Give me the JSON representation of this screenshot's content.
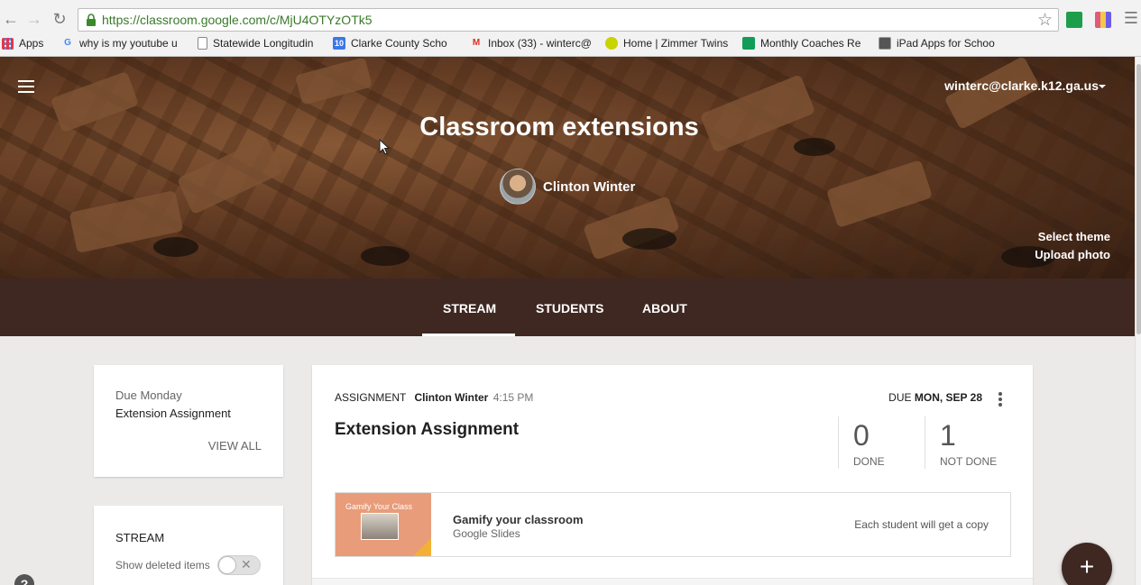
{
  "browser": {
    "url": "https://classroom.google.com/c/MjU4OTYzOTk5",
    "bookmarks": [
      {
        "label": "Apps",
        "icon": "apps-grid-icon"
      },
      {
        "label": "why is my youtube u",
        "icon": "google-icon"
      },
      {
        "label": "Statewide Longitudin",
        "icon": "document-icon"
      },
      {
        "label": "Clarke County Scho",
        "icon": "calendar-icon"
      },
      {
        "label": "Inbox (33) - winterc@",
        "icon": "gmail-icon"
      },
      {
        "label": "Home | Zimmer Twins",
        "icon": "zimmer-icon"
      },
      {
        "label": "Monthly Coaches Re",
        "icon": "sheets-icon"
      },
      {
        "label": "iPad Apps for Schoo",
        "icon": "bookmark-image-icon"
      }
    ]
  },
  "header": {
    "account": "winterc@clarke.k12.ga.us",
    "class_title": "Classroom extensions",
    "teacher": "Clinton Winter",
    "select_theme": "Select theme",
    "upload_photo": "Upload photo",
    "theme_color": "#3f2822"
  },
  "tabs": [
    {
      "label": "STREAM",
      "active": true
    },
    {
      "label": "STUDENTS",
      "active": false
    },
    {
      "label": "ABOUT",
      "active": false
    }
  ],
  "sidebar": {
    "due_label": "Due Monday",
    "due_assignment": "Extension Assignment",
    "view_all": "VIEW ALL",
    "stream_title": "STREAM",
    "show_deleted": "Show deleted items",
    "show_deleted_on": false
  },
  "post": {
    "type": "ASSIGNMENT",
    "author": "Clinton Winter",
    "time": "4:15 PM",
    "due_prefix": "DUE",
    "due_date": "MON, SEP 28",
    "title": "Extension Assignment",
    "done_count": "0",
    "done_label": "DONE",
    "not_done_count": "1",
    "not_done_label": "NOT DONE",
    "attachment": {
      "thumb_title": "Gamify Your Class",
      "title": "Gamify your classroom",
      "subtitle": "Google Slides",
      "copy_note": "Each student will get a copy"
    }
  },
  "fab_label": "+",
  "help_label": "?"
}
